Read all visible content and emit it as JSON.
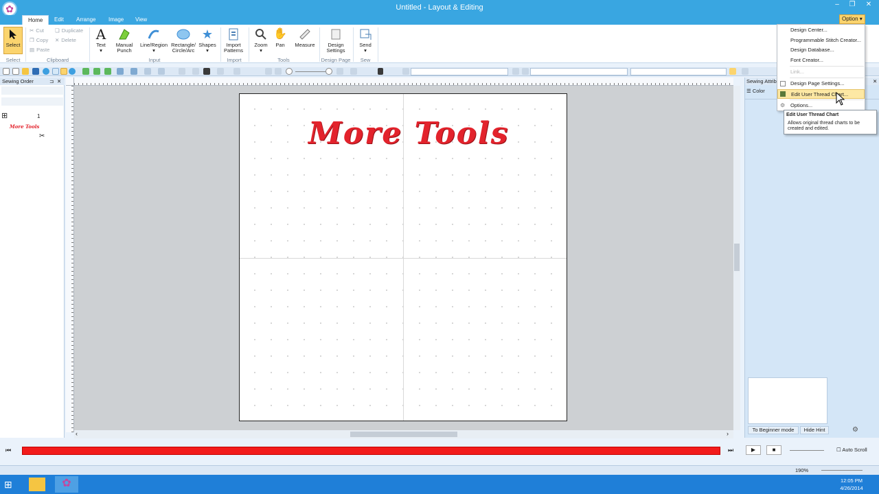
{
  "window": {
    "title": "Untitled - Layout & Editing",
    "minimize": "–",
    "restore": "❐",
    "close": "✕"
  },
  "tabs": [
    "Home",
    "Edit",
    "Arrange",
    "Image",
    "View"
  ],
  "option_button": "Option",
  "ribbon": {
    "select": {
      "label": "Select",
      "group": "Select"
    },
    "clipboard": {
      "cut": "Cut",
      "copy": "Copy",
      "paste": "Paste",
      "duplicate": "Duplicate",
      "delete": "Delete",
      "group": "Clipboard"
    },
    "input": {
      "text": "Text",
      "manual_punch": "Manual Punch",
      "line_region": "Line/Region",
      "rect": "Rectangle/ Circle/Arc",
      "shapes": "Shapes",
      "group": "Input"
    },
    "import": {
      "import_patterns": "Import Patterns",
      "group": "Import"
    },
    "tools": {
      "zoom": "Zoom",
      "pan": "Pan",
      "measure": "Measure",
      "group": "Tools"
    },
    "design_page": {
      "settings": "Design Settings",
      "group": "Design Page"
    },
    "sew": {
      "send": "Send",
      "group": "Sew"
    }
  },
  "left_panel": {
    "title": "Sewing Order",
    "row_number": "1",
    "thumb_text": "More Tools"
  },
  "design": {
    "text": "More Tools",
    "color": "#e3232c"
  },
  "right_panel": {
    "title": "Sewing Attrib",
    "color_tab": "Color",
    "beginner_mode": "To Beginner mode",
    "hide_hint": "Hide Hint"
  },
  "option_menu": {
    "items": [
      {
        "label": "Design Center...",
        "enabled": true
      },
      {
        "label": "Programmable Stitch Creator...",
        "enabled": true
      },
      {
        "label": "Design Database...",
        "enabled": true
      },
      {
        "label": "Font Creator...",
        "enabled": true
      },
      {
        "label": "Link...",
        "enabled": false
      },
      {
        "label": "Design Page Settings...",
        "enabled": true
      },
      {
        "label": "Edit User Thread Chart...",
        "enabled": true,
        "highlighted": true
      },
      {
        "label": "Options...",
        "enabled": true
      }
    ]
  },
  "tooltip": {
    "title": "Edit User Thread Chart",
    "body": "Allows original thread charts to be created and edited."
  },
  "playback": {
    "auto_scroll": "Auto Scroll",
    "progress": 1.0
  },
  "status": {
    "zoom": "190%"
  },
  "taskbar": {
    "time": "12:05 PM",
    "date": "4/26/2014"
  }
}
